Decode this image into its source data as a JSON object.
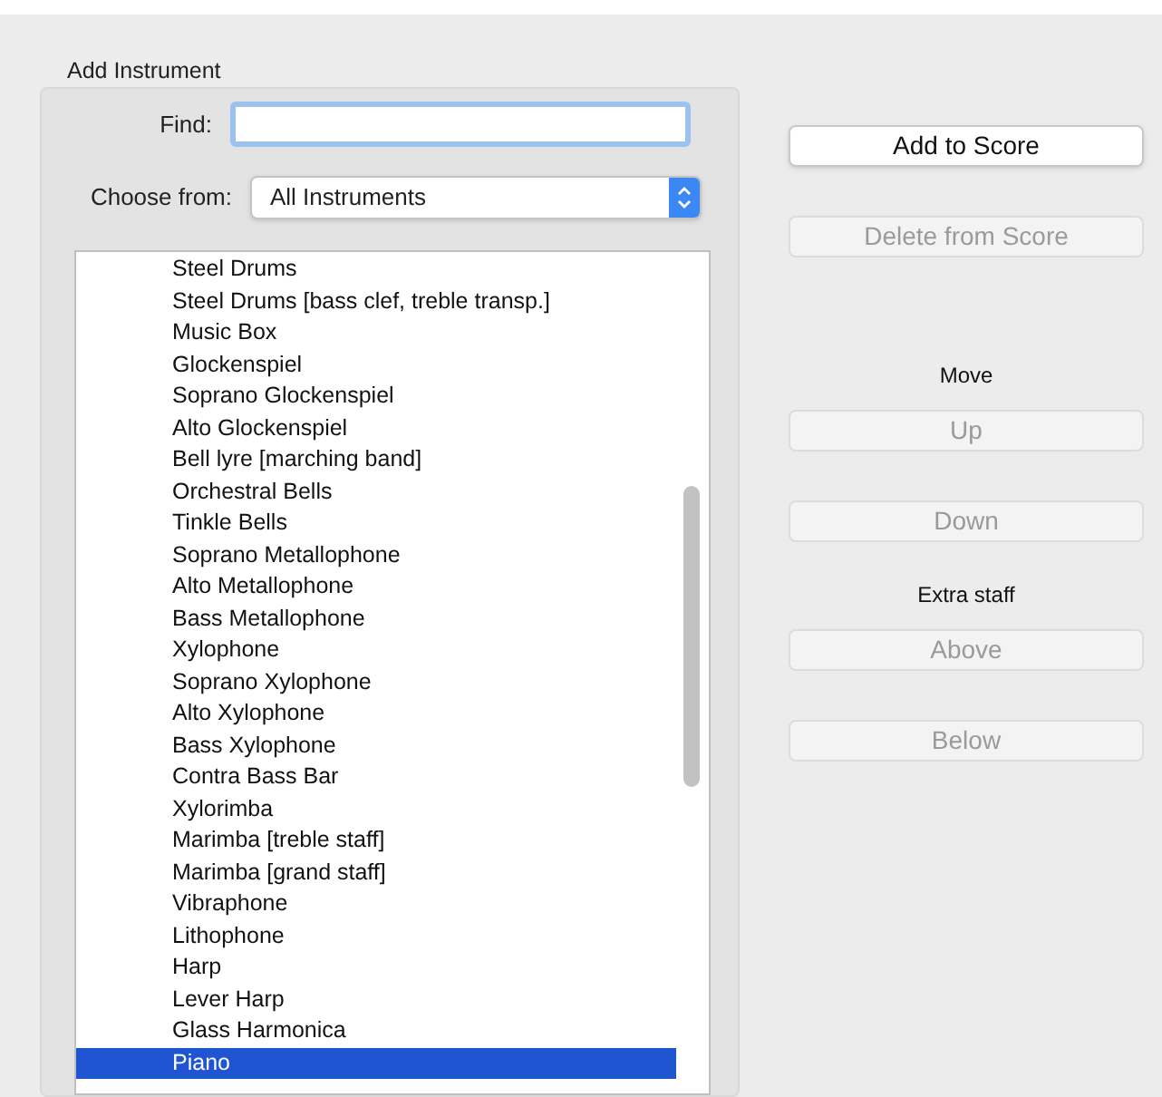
{
  "group": {
    "title": "Add Instrument"
  },
  "find": {
    "label": "Find:"
  },
  "choose": {
    "label": "Choose from:",
    "value": "All Instruments"
  },
  "instruments": [
    {
      "name": "Steel Drums",
      "selected": false
    },
    {
      "name": "Steel Drums [bass clef, treble transp.]",
      "selected": false
    },
    {
      "name": "Music Box",
      "selected": false
    },
    {
      "name": "Glockenspiel",
      "selected": false
    },
    {
      "name": "Soprano Glockenspiel",
      "selected": false
    },
    {
      "name": "Alto Glockenspiel",
      "selected": false
    },
    {
      "name": "Bell lyre [marching band]",
      "selected": false
    },
    {
      "name": "Orchestral Bells",
      "selected": false
    },
    {
      "name": "Tinkle Bells",
      "selected": false
    },
    {
      "name": "Soprano Metallophone",
      "selected": false
    },
    {
      "name": "Alto Metallophone",
      "selected": false
    },
    {
      "name": "Bass Metallophone",
      "selected": false
    },
    {
      "name": "Xylophone",
      "selected": false
    },
    {
      "name": "Soprano Xylophone",
      "selected": false
    },
    {
      "name": "Alto Xylophone",
      "selected": false
    },
    {
      "name": "Bass Xylophone",
      "selected": false
    },
    {
      "name": "Contra Bass Bar",
      "selected": false
    },
    {
      "name": "Xylorimba",
      "selected": false
    },
    {
      "name": "Marimba [treble staff]",
      "selected": false
    },
    {
      "name": "Marimba [grand staff]",
      "selected": false
    },
    {
      "name": "Vibraphone",
      "selected": false
    },
    {
      "name": "Lithophone",
      "selected": false
    },
    {
      "name": "Harp",
      "selected": false
    },
    {
      "name": "Lever Harp",
      "selected": false
    },
    {
      "name": "Glass Harmonica",
      "selected": false
    },
    {
      "name": "Piano",
      "selected": true
    }
  ],
  "actions": [
    {
      "kind": "button",
      "label": "Add to Score",
      "disabled": false
    },
    {
      "kind": "button",
      "label": "Delete from Score",
      "disabled": true
    },
    {
      "kind": "heading",
      "label": "Move"
    },
    {
      "kind": "button",
      "label": "Up",
      "disabled": true
    },
    {
      "kind": "button",
      "label": "Down",
      "disabled": true
    },
    {
      "kind": "heading",
      "label": "Extra staff"
    },
    {
      "kind": "button",
      "label": "Above",
      "disabled": true
    },
    {
      "kind": "button",
      "label": "Below",
      "disabled": true
    }
  ]
}
